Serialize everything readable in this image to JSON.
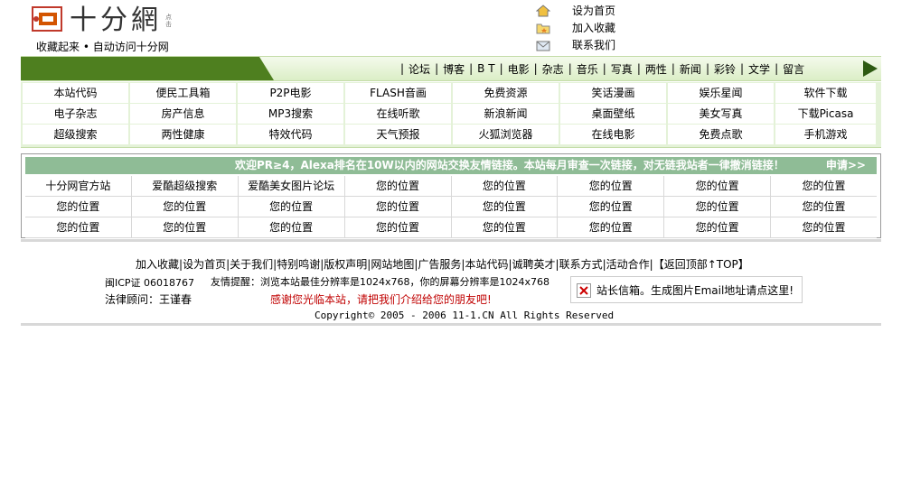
{
  "header": {
    "logo_text": "十分網",
    "logo_sub": "点击",
    "tagline": "收藏起来 • 自动访问十分网",
    "top_links": [
      "设为首页",
      "加入收藏",
      "联系我们"
    ]
  },
  "nav": {
    "links": [
      "论坛",
      "博客",
      "B T",
      "电影",
      "杂志",
      "音乐",
      "写真",
      "两性",
      "新闻",
      "彩铃",
      "文学",
      "留言"
    ]
  },
  "categories": [
    [
      "本站代码",
      "便民工具箱",
      "P2P电影",
      "FLASH音画",
      "免费资源",
      "笑话漫画",
      "娱乐星闻",
      "软件下载"
    ],
    [
      "电子杂志",
      "房产信息",
      "MP3搜索",
      "在线听歌",
      "新浪新闻",
      "桌面壁纸",
      "美女写真",
      "下载Picasa"
    ],
    [
      "超级搜索",
      "两性健康",
      "特效代码",
      "天气预报",
      "火狐浏览器",
      "在线电影",
      "免费点歌",
      "手机游戏"
    ]
  ],
  "friends": {
    "banner": "欢迎PR≥4，Alexa排名在10W以内的网站交换友情链接。本站每月审查一次链接，对无链我站者一律撤消链接！",
    "apply": "申请>>",
    "rows": [
      [
        "十分网官方站",
        "爱酷超级搜索",
        "爱酷美女图片论坛",
        "您的位置",
        "您的位置",
        "您的位置",
        "您的位置",
        "您的位置"
      ],
      [
        "您的位置",
        "您的位置",
        "您的位置",
        "您的位置",
        "您的位置",
        "您的位置",
        "您的位置",
        "您的位置"
      ],
      [
        "您的位置",
        "您的位置",
        "您的位置",
        "您的位置",
        "您的位置",
        "您的位置",
        "您的位置",
        "您的位置"
      ]
    ]
  },
  "footer": {
    "links": [
      "加入收藏",
      "设为首页",
      "关于我们",
      "特别鸣谢",
      "版权声明",
      "网站地图",
      "广告服务",
      "本站代码",
      "诚聘英才",
      "联系方式",
      "活动合作",
      "【返回顶部↑TOP】"
    ],
    "icp": "闽ICP证 06018767",
    "tip": "友情提醒：浏览本站最佳分辨率是1024x768，你的屏幕分辨率是1024x768",
    "lawyer": "法律顾问：王谨春",
    "thanks": "感谢您光临本站，请把我们介绍给您的朋友吧!",
    "mail": "站长信箱。生成图片Email地址请点这里!",
    "copyright": "Copyright© 2005 - 2006 11-1.CN All Rights Reserved"
  },
  "colors": {
    "nav_green": "#4e7f1f",
    "banner_green": "#8fbc96",
    "thanks_red": "#c00000"
  }
}
